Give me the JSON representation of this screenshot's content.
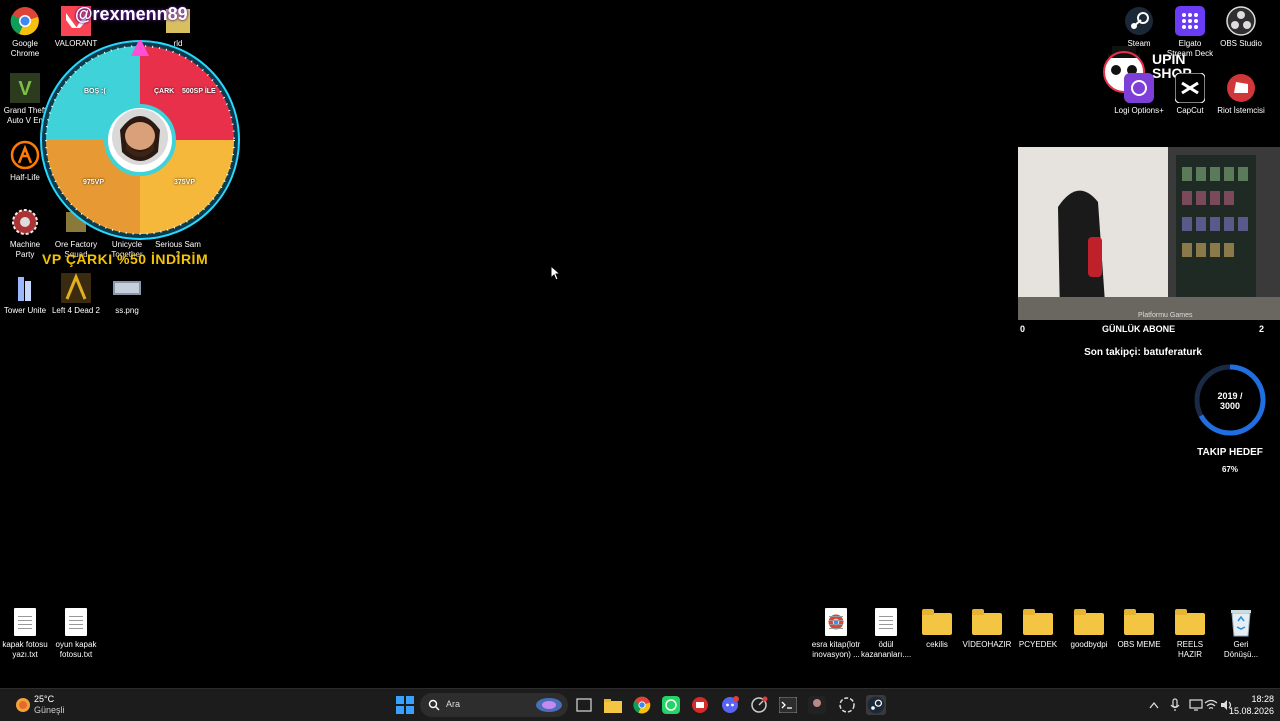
{
  "desktop": {
    "left_icons": [
      {
        "label": "Google Chrome",
        "icon": "chrome-icon"
      },
      {
        "label": "VALORANT",
        "icon": "valorant-icon"
      },
      {
        "label": "rld",
        "icon": "game-icon"
      },
      {
        "label": "Grand Theft Auto V En",
        "icon": "gta-icon"
      },
      {
        "label": "Half-Life",
        "icon": "halflife-icon"
      },
      {
        "label": "Machine Party",
        "icon": "machine-party-icon"
      },
      {
        "label": "Ore Factory Squad",
        "icon": "ore-factory-icon"
      },
      {
        "label": "Unicycle Together",
        "icon": "unicycle-icon"
      },
      {
        "label": "Serious Sam 2",
        "icon": "serious-sam-icon"
      },
      {
        "label": "Tower Unite",
        "icon": "tower-unite-icon"
      },
      {
        "label": "Left 4 Dead 2",
        "icon": "l4d2-icon"
      },
      {
        "label": "ss.png",
        "icon": "image-icon"
      }
    ],
    "bottom_left_files": [
      {
        "label": "kapak fotosu yazı.txt",
        "icon": "text-file-icon"
      },
      {
        "label": "oyun kapak fotosu.txt",
        "icon": "text-file-icon"
      }
    ],
    "right_icons": [
      {
        "label": "Steam",
        "icon": "steam-icon"
      },
      {
        "label": "Elgato Stream Deck",
        "icon": "stream-deck-icon"
      },
      {
        "label": "OBS Studio",
        "icon": "obs-icon"
      },
      {
        "label": "Logi Options+",
        "icon": "logi-icon"
      },
      {
        "label": "CapCut",
        "icon": "capcut-icon"
      },
      {
        "label": "Riot İstemcisi",
        "icon": "riot-icon"
      }
    ],
    "bottom_right_items": [
      {
        "label": "esra kitap(lotr inovasyon) ...",
        "icon": "chrome-shortcut-icon"
      },
      {
        "label": "ödül kazananları....",
        "icon": "text-file-icon"
      },
      {
        "label": "cekilis",
        "icon": "folder-icon"
      },
      {
        "label": "VİDEOHAZIR",
        "icon": "folder-icon"
      },
      {
        "label": "PCYEDEK",
        "icon": "folder-icon"
      },
      {
        "label": "goodbydpi",
        "icon": "folder-icon"
      },
      {
        "label": "OBS MEME",
        "icon": "folder-icon"
      },
      {
        "label": "REELS HAZIR",
        "icon": "folder-icon"
      },
      {
        "label": "Geri Dönüşü...",
        "icon": "recycle-bin-icon"
      }
    ]
  },
  "overlay": {
    "handle": "@rexmenn89",
    "wheel_segments": [
      "BOŞ :(",
      "ÇARK",
      "500SP İLE",
      "975VP",
      "375VP"
    ],
    "promo": "VP ÇARKI %50 İNDİRİM",
    "brand": "UPIN SHOP",
    "webcam_caption": "Platformu    Games",
    "sub_left": "0",
    "sub_title": "GÜNLÜK ABONE",
    "sub_right": "2",
    "last_follower": "Son takipçi: batuferaturk",
    "goal_current": "2019 /",
    "goal_target": "3000",
    "goal_progress": 0.67,
    "goal_title": "TAKIP HEDEF",
    "goal_percent": "67%"
  },
  "taskbar": {
    "weather_temp": "25°C",
    "weather_desc": "Güneşli",
    "search_placeholder": "Ara",
    "time": "18:28",
    "date": "15.08.2026",
    "apps": [
      "start-icon",
      "search-icon",
      "task-view-icon",
      "file-explorer-icon",
      "chrome-icon",
      "whatsapp-icon",
      "app-red-icon",
      "discord-icon",
      "app-speed-icon",
      "terminal-icon",
      "app-avatar-icon",
      "chatgpt-icon",
      "steam-icon"
    ],
    "tray": [
      "chevron-up-icon",
      "microphone-icon",
      "display-icon",
      "wifi-icon",
      "volume-icon"
    ]
  },
  "colors": {
    "wheel_cyan": "#3fd2d8",
    "wheel_red": "#e8304a",
    "wheel_orange": "#e79a33",
    "wheel_yellow": "#f6b83a",
    "ring_blue": "#1f6fe0",
    "promo": "#f5c400"
  }
}
